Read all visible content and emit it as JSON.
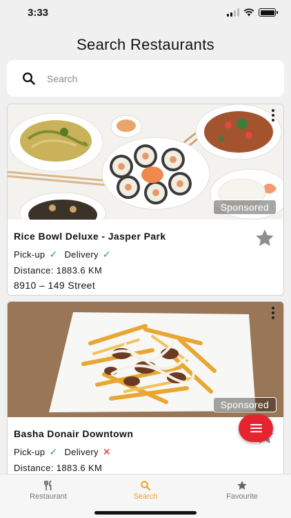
{
  "status_bar": {
    "time": "3:33"
  },
  "header": {
    "title": "Search Restaurants"
  },
  "search": {
    "placeholder": "Search",
    "value": ""
  },
  "restaurants": [
    {
      "name": "Rice Bowl Deluxe - Jasper Park",
      "badge": "Sponsored",
      "pickup_label": "Pick-up",
      "pickup_mark": "✓",
      "delivery_label": "Delivery",
      "delivery_mark": "✓",
      "distance": "Distance: 1883.6 KM",
      "address": "8910 – 149 Street"
    },
    {
      "name": "Basha Donair Downtown",
      "badge": "Sponsored",
      "pickup_label": "Pick-up",
      "pickup_mark": "✓",
      "delivery_label": "Delivery",
      "delivery_mark": "✕",
      "distance": "Distance: 1883.6 KM"
    }
  ],
  "tabs": [
    {
      "label": "Restaurant",
      "icon": "fork-knife-icon"
    },
    {
      "label": "Search",
      "icon": "search-icon",
      "active": true
    },
    {
      "label": "Favourite",
      "icon": "star-icon"
    }
  ],
  "colors": {
    "accent": "#f0a21c",
    "fab": "#e4242f",
    "check": "#2ba84a",
    "cross": "#e0293a"
  }
}
